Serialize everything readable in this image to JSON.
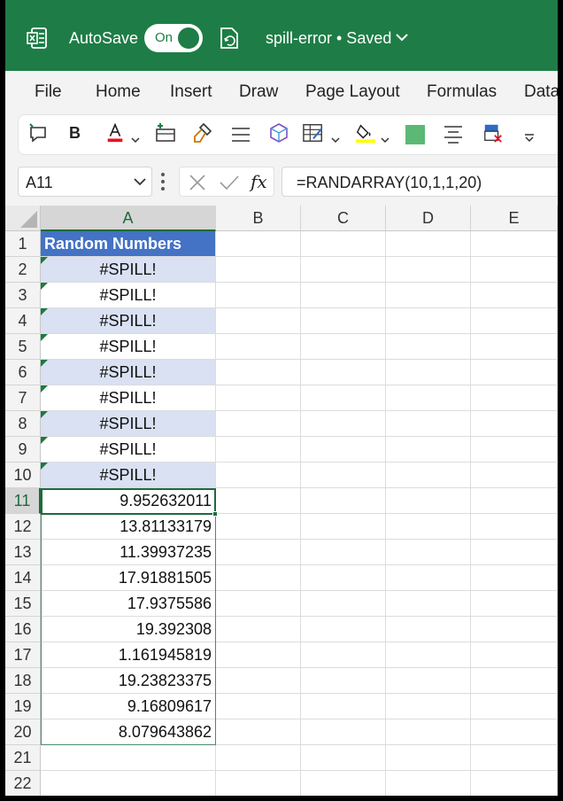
{
  "titlebar": {
    "autosave_label": "AutoSave",
    "toggle_state": "On",
    "document_title": "spill-error • Saved"
  },
  "menu": [
    "File",
    "Home",
    "Insert",
    "Draw",
    "Page Layout",
    "Formulas",
    "Data"
  ],
  "toolbar": {
    "bold_label": "B",
    "font_color": "#e81123",
    "highlight_color": "#ffff00",
    "fill_swatch_color": "#5bb975"
  },
  "formula_bar": {
    "name_box": "A11",
    "fx_label": "fx",
    "formula": "=RANDARRAY(10,1,1,20)"
  },
  "columns": [
    "A",
    "B",
    "C",
    "D",
    "E"
  ],
  "rows": [
    "1",
    "2",
    "3",
    "4",
    "5",
    "6",
    "7",
    "8",
    "9",
    "10",
    "11",
    "12",
    "13",
    "14",
    "15",
    "16",
    "17",
    "18",
    "19",
    "20",
    "21",
    "22"
  ],
  "sheet": {
    "header_cell": "Random Numbers",
    "spill_cells": [
      "#SPILL!",
      "#SPILL!",
      "#SPILL!",
      "#SPILL!",
      "#SPILL!",
      "#SPILL!",
      "#SPILL!",
      "#SPILL!",
      "#SPILL!"
    ],
    "values": [
      "9.952632011",
      "13.81133179",
      "11.39937235",
      "17.91881505",
      "17.9375586",
      "19.392308",
      "1.161945819",
      "19.23823375",
      "9.16809617",
      "8.079643862"
    ]
  },
  "colors": {
    "title_green": "#1e7d46",
    "table_header_blue": "#4472c4",
    "table_band": "#d9e1f2",
    "selection_green": "#1e6b3c"
  }
}
